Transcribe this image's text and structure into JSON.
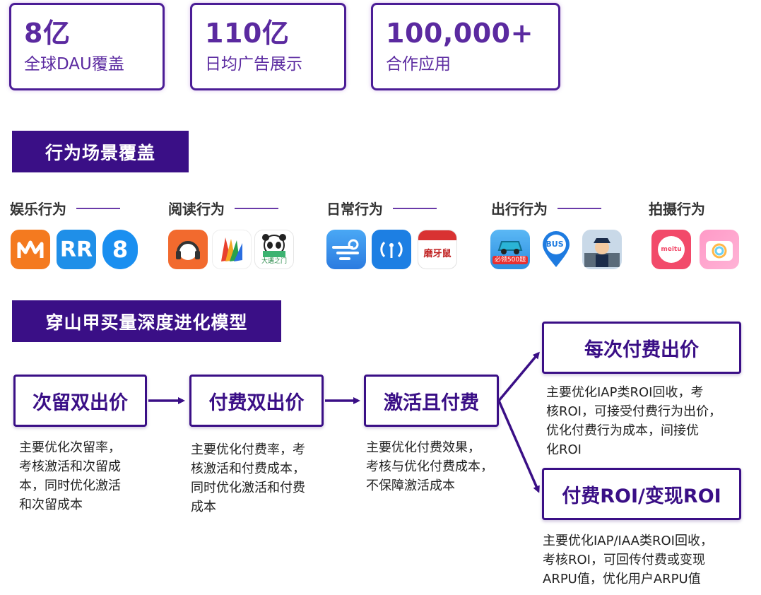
{
  "stats": [
    {
      "value": "8亿",
      "label": "全球DAU覆盖"
    },
    {
      "value": "110亿",
      "label": "日均广告展示"
    },
    {
      "value": "100,000+",
      "label": "合作应用"
    }
  ],
  "section1": {
    "title": "行为场景覆盖"
  },
  "categories": [
    {
      "label": "娱乐行为"
    },
    {
      "label": "阅读行为"
    },
    {
      "label": "日常行为"
    },
    {
      "label": "出行行为"
    },
    {
      "label": "拍摄行为"
    }
  ],
  "apps": {
    "mgtv": "mgtv-icon",
    "rr": "rr-icon",
    "eight": "eight-icon",
    "headphones": "headphones-icon",
    "book": "book-icon",
    "panda": "panda-icon",
    "weather": "weather-icon",
    "wifi": "wifi-icon",
    "calendar": "calendar-icon",
    "car": "car-icon",
    "bus": "bus-icon",
    "police": "police-icon",
    "meitu": "meitu-icon",
    "camera": "camera-icon",
    "rr_text": "RR",
    "eight_text": "8",
    "panda_caption": "大遇之门",
    "calendar_text": "磨牙鼠",
    "car_badge": "必领500题",
    "bus_text": "BUS",
    "meitu_text": "meitu"
  },
  "section2": {
    "title": "穿山甲买量深度进化模型"
  },
  "steps": [
    {
      "label": "次留双出价",
      "desc": [
        "主要优化次留率，",
        "考核激活和次留成",
        "本，同时优化激活",
        "和次留成本"
      ]
    },
    {
      "label": "付费双出价",
      "desc": [
        "主要优化付费率，考",
        "核激活和付费成本，",
        "同时优化激活和付费",
        "成本"
      ]
    },
    {
      "label": "激活且付费",
      "desc": [
        "主要优化付费效果，",
        "考核与优化付费成本，",
        "不保障激活成本"
      ]
    },
    {
      "label": "每次付费出价",
      "desc": [
        "主要优化IAP类ROI回收，考",
        "核ROI，可接受付费行为出价，",
        "优化付费行为成本，间接优",
        "化ROI"
      ]
    },
    {
      "label": "付费ROI/变现ROI",
      "desc": [
        "主要优化IAP/IAA类ROI回收，",
        "考核ROI，可回传付费或变现",
        "ARPU值，优化用户ARPU值"
      ]
    }
  ],
  "colors": {
    "primary": "#3a0f86",
    "accent": "#5b2aa0"
  }
}
